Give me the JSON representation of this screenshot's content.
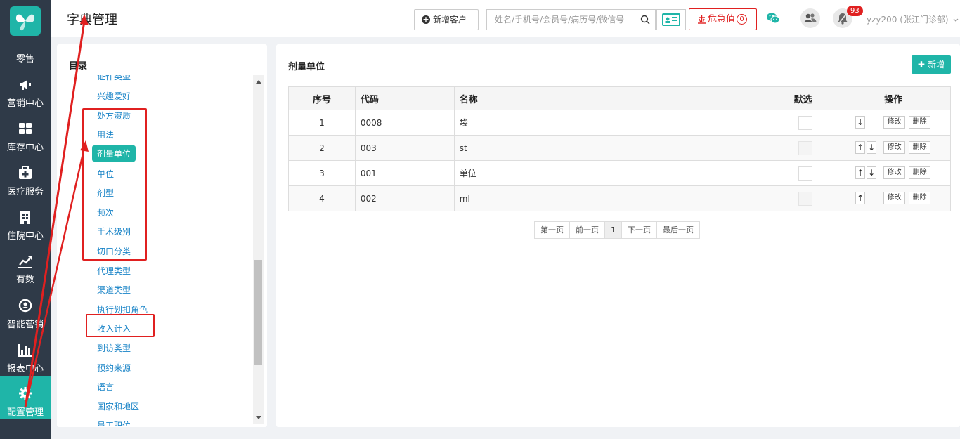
{
  "header": {
    "title": "字典管理",
    "add_customer_label": "新增客户",
    "search_placeholder": "姓名/手机号/会员号/病历号/微信号",
    "danger_label": "危急值",
    "danger_count": "0",
    "notification_count": "93",
    "user": "yzy200 (张江门诊部)"
  },
  "nav": {
    "items": [
      {
        "label": "零售",
        "icon": "store-icon"
      },
      {
        "label": "营销中心",
        "icon": "megaphone-icon"
      },
      {
        "label": "库存中心",
        "icon": "grid-icon"
      },
      {
        "label": "医疗服务",
        "icon": "medkit-icon"
      },
      {
        "label": "住院中心",
        "icon": "hospital-icon"
      },
      {
        "label": "有数",
        "icon": "trend-icon"
      },
      {
        "label": "智能营销",
        "icon": "smart-icon"
      },
      {
        "label": "报表中心",
        "icon": "bar-chart-icon"
      },
      {
        "label": "配置管理",
        "icon": "gear-icon"
      }
    ]
  },
  "catalog": {
    "title": "目录",
    "items": [
      "证件类型",
      "兴趣爱好",
      "处方资质",
      "用法",
      "剂量单位",
      "单位",
      "剂型",
      "频次",
      "手术级别",
      "切口分类",
      "代理类型",
      "渠道类型",
      "执行划扣角色",
      "收入计入",
      "到访类型",
      "预约来源",
      "语言",
      "国家和地区",
      "员工职位"
    ],
    "active": "剂量单位"
  },
  "main": {
    "title": "剂量单位",
    "new_label": "新增",
    "columns": [
      "序号",
      "代码",
      "名称",
      "默选",
      "操作"
    ],
    "rows": [
      {
        "no": "1",
        "code": "0008",
        "name": "袋"
      },
      {
        "no": "2",
        "code": "003",
        "name": "st"
      },
      {
        "no": "3",
        "code": "001",
        "name": "单位"
      },
      {
        "no": "4",
        "code": "002",
        "name": "ml"
      }
    ],
    "edit_label": "修改",
    "delete_label": "删除",
    "up_arrow": "↑",
    "down_arrow": "↓"
  },
  "pager": {
    "first": "第一页",
    "prev": "前一页",
    "current": "1",
    "next": "下一页",
    "last": "最后一页"
  },
  "colors": {
    "accent": "#1fb5a8",
    "nav_bg": "#2f3a48",
    "annotation": "#e02020",
    "link": "#1a84c7"
  }
}
